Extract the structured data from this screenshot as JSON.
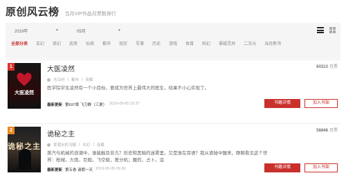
{
  "header": {
    "title": "原创风云榜",
    "subtitle": "当月VIP作品月票数排行"
  },
  "filters": {
    "year": "2019年",
    "month": "05月",
    "view_list_icon": "list-view-icon",
    "view_grid_icon": "grid-view-icon"
  },
  "categories": [
    "全部分类",
    "玄幻",
    "奇幻",
    "武侠",
    "仙侠",
    "都市",
    "现实",
    "军事",
    "历史",
    "游戏",
    "体育",
    "科幻",
    "悬疑灵异",
    "二次元",
    "当月新书"
  ],
  "active_category": "全部分类",
  "books": [
    {
      "rank": "1",
      "cover_title": "大医凌然",
      "title": "大医凌然",
      "author": "志鸟村",
      "genre": "都市",
      "status": "连载",
      "description": "医学院学生凌然有一个小目标，要成为世界上最伟大的医生，结果不小心实现了。",
      "latest_tag": "最新更新",
      "latest_chapter": "第697章 飞刀群（三更）",
      "latest_time": "2019-05-05 22:37",
      "votes": "60310",
      "votes_unit": "月票",
      "detail_button": "书籍详情",
      "shelf_button": "加入书架"
    },
    {
      "rank": "2",
      "cover_title": "诡秘之主",
      "title": "诡秘之主",
      "author": "爱潜水的乌贼",
      "genre": "玄幻",
      "status": "连载",
      "description": "蒸汽与机械的浪潮中，谁能触及非凡？历史和黑暗的迷雾里，又是谁在耳语？我从诡秘中醒来，睁眼看见这个世界：枪械，大炮，巨舰，飞空艇，差分机；魔药，占卜，诅",
      "latest_tag": "最新更新",
      "latest_chapter": "第五卷 请假一天",
      "latest_time": "2019-05-05 09:30",
      "votes": "56846",
      "votes_unit": "月票",
      "detail_button": "书籍详情",
      "shelf_button": "加入书架"
    }
  ],
  "colors": {
    "accent": "#c9302c",
    "rank1": "#d9342b",
    "rank2": "#e8891e"
  }
}
